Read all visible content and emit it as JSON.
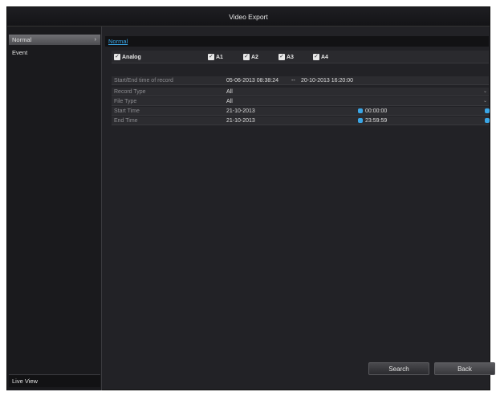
{
  "window": {
    "title": "Video Export"
  },
  "sidebar": {
    "items": [
      {
        "label": "Normal",
        "selected": true,
        "arrow": "›"
      },
      {
        "label": "Event",
        "selected": false
      }
    ],
    "footer_label": "Live View"
  },
  "tabs": [
    {
      "label": "Normal",
      "active": true
    }
  ],
  "form": {
    "analog": {
      "label": "Analog",
      "checked": true
    },
    "channels": [
      {
        "label": "A1",
        "checked": true
      },
      {
        "label": "A2",
        "checked": true
      },
      {
        "label": "A3",
        "checked": true
      },
      {
        "label": "A4",
        "checked": true
      }
    ],
    "checkmark": "✓",
    "record_range": {
      "label": "Start/End time of record",
      "start": "05-06-2013 08:38:24",
      "separator": "--",
      "end": "20-10-2013 16:20:00"
    },
    "record_type": {
      "label": "Record Type",
      "value": "All"
    },
    "file_type": {
      "label": "File Type",
      "value": "All"
    },
    "start_time": {
      "label": "Start Time",
      "date": "21-10-2013",
      "time": "00:00:00"
    },
    "end_time": {
      "label": "End Time",
      "date": "21-10-2013",
      "time": "23:59:59"
    },
    "dropdown_glyph": "⌄"
  },
  "buttons": {
    "search": "Search",
    "back": "Back"
  },
  "colors": {
    "accent": "#3aa6e6",
    "background": "#222226",
    "title_bar": "#141417"
  },
  "icons": {
    "clock": "clock-icon",
    "calendar": "calendar-icon",
    "dropdown": "chevron-down-icon",
    "checkbox": "checkbox-icon"
  }
}
